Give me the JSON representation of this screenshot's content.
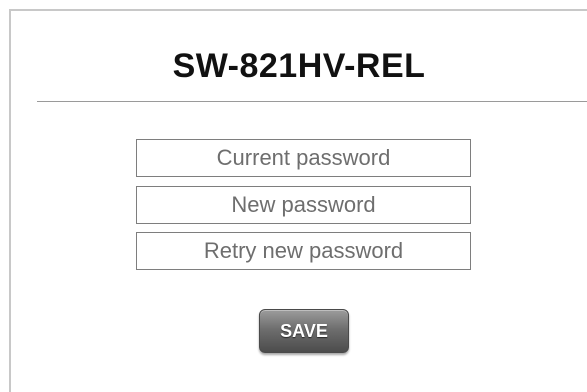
{
  "header": {
    "title": "SW-821HV-REL"
  },
  "form": {
    "current_password": {
      "value": "",
      "placeholder": "Current password"
    },
    "new_password": {
      "value": "",
      "placeholder": "New password"
    },
    "retry_password": {
      "value": "",
      "placeholder": "Retry new password"
    },
    "save_label": "SAVE"
  },
  "colors": {
    "frame_border": "#c8c8c8",
    "divider": "#9a9a9a",
    "field_border": "#7e7e7e",
    "button_gradient_top": "#9c9c9c",
    "button_gradient_bottom": "#4c4c4c",
    "button_text": "#ffffff"
  }
}
